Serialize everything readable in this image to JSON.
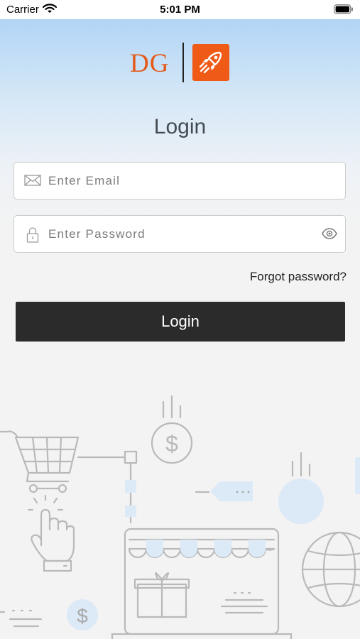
{
  "status_bar": {
    "carrier": "Carrier",
    "time": "5:01 PM"
  },
  "logo": {
    "text": "DG",
    "brand_color": "#ef5a16"
  },
  "login_form": {
    "title": "Login",
    "email_placeholder": "Enter Email",
    "email_value": "",
    "password_placeholder": "Enter Password",
    "password_value": "",
    "forgot_password_label": "Forgot password?",
    "login_button_label": "Login"
  },
  "illustration": {
    "price_symbol_1": "$",
    "price_symbol_2": "$"
  },
  "colors": {
    "accent": "#ef5a16",
    "button": "#2b2b2b",
    "header_gradient_top": "#a9d0f5",
    "background": "#f3f3f3",
    "illustration_line": "#b9b9b9",
    "illustration_fill": "#dce9f6"
  }
}
